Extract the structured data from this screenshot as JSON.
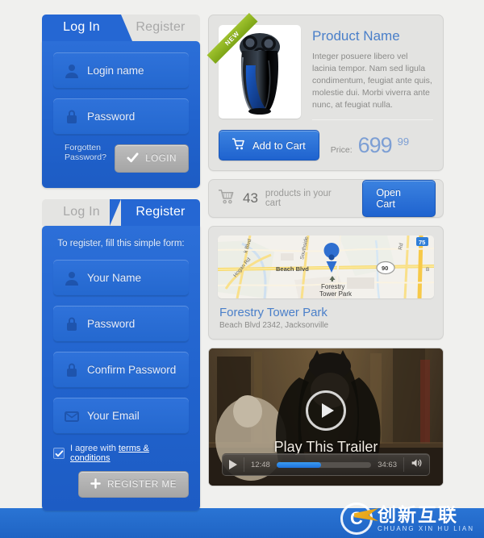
{
  "login_panel": {
    "tabs": [
      {
        "label": "Log In",
        "active": true
      },
      {
        "label": "Register",
        "active": false
      }
    ],
    "fields": [
      {
        "icon": "user-icon",
        "placeholder": "Login name"
      },
      {
        "icon": "lock-icon",
        "placeholder": "Password"
      }
    ],
    "forgot_text": "Forgotten Password?",
    "submit_label": "LOGIN",
    "submit_icon": "check-icon"
  },
  "register_panel": {
    "tabs": [
      {
        "label": "Log In",
        "active": false
      },
      {
        "label": "Register",
        "active": true
      }
    ],
    "intro": "To register, fill this simple form:",
    "fields": [
      {
        "icon": "user-icon",
        "placeholder": "Your Name"
      },
      {
        "icon": "lock-icon",
        "placeholder": "Password"
      },
      {
        "icon": "lock-icon",
        "placeholder": "Confirm Password"
      },
      {
        "icon": "envelope-icon",
        "placeholder": "Your Email"
      }
    ],
    "agree_prefix": "I agree with ",
    "agree_link": "terms & conditions",
    "agree_checked": true,
    "submit_label": "REGISTER ME",
    "submit_icon": "plus-icon"
  },
  "product": {
    "ribbon": "NEW",
    "name": "Product Name",
    "description": "Integer posuere libero vel lacinia tempor. Nam sed ligula condimentum, feugiat ante quis, molestie dui. Morbi viverra ante nunc, at feugiat nulla.",
    "add_to_cart_label": "Add to Cart",
    "add_to_cart_icon": "cart-icon",
    "price_label": "Price:",
    "price_main": "699",
    "price_cents": "99"
  },
  "cart_bar": {
    "icon": "cart-icon",
    "count": "43",
    "text": "products in your cart",
    "open_label": "Open Cart"
  },
  "map_card": {
    "title": "Forestry Tower Park",
    "address": "Beach Blvd 2342, Jacksonville",
    "marker_label": "Forestry Tower Park",
    "labels": [
      "Beach Blvd",
      "Southside",
      "Hogan Rd",
      "Rd",
      "75",
      "90",
      "Blvd"
    ]
  },
  "video": {
    "title": "Play This Trailer",
    "play_icon": "play-icon",
    "current_time": "12:48",
    "total_time": "34:63",
    "progress_percent": 47,
    "volume_icon": "speaker-icon"
  },
  "footer": {
    "watermark_cn": "创新互联",
    "watermark_en": "CHUANG XIN HU LIAN"
  },
  "colors": {
    "brand_blue": "#2567d3",
    "page_bg": "#f0f0ee",
    "card_bg": "#e3e3e1",
    "link_blue": "#4a7fc9",
    "ribbon_green": "#7da516"
  }
}
